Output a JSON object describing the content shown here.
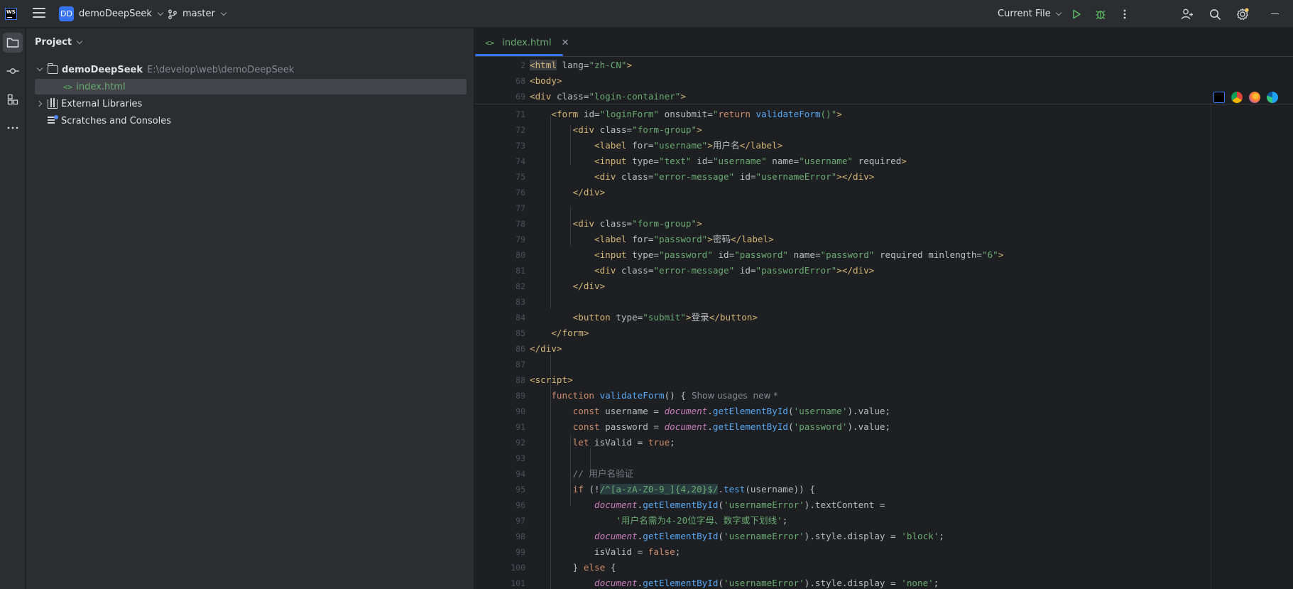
{
  "titlebar": {
    "logo_text": "WS",
    "project_badge": "DD",
    "project_name": "demoDeepSeek",
    "branch": "master",
    "run_config": "Current File"
  },
  "project_panel": {
    "title": "Project",
    "tree": {
      "root_name": "demoDeepSeek",
      "root_path": "E:\\develop\\web\\demoDeepSeek",
      "file": "index.html",
      "external_libraries": "External Libraries",
      "scratches": "Scratches and Consoles"
    }
  },
  "editor": {
    "tab_label": "index.html",
    "tab_icon": "<>",
    "sticky_lines": [
      {
        "n": "2"
      },
      {
        "n": "68"
      },
      {
        "n": "69"
      }
    ],
    "line_numbers": [
      "71",
      "72",
      "73",
      "74",
      "75",
      "76",
      "77",
      "78",
      "79",
      "80",
      "81",
      "82",
      "83",
      "84",
      "85",
      "86",
      "87",
      "88",
      "89",
      "90",
      "91",
      "92",
      "93",
      "94",
      "95",
      "96",
      "97",
      "98",
      "99",
      "100",
      "101"
    ],
    "inlay_hint_usages": "Show usages",
    "inlay_hint_new": "new *"
  },
  "colors": {
    "accent": "#3574f0",
    "tag": "#d5b778",
    "string": "#6aab73",
    "keyword": "#cf8e6d",
    "function": "#56a8f5",
    "global": "#c77dbb"
  }
}
